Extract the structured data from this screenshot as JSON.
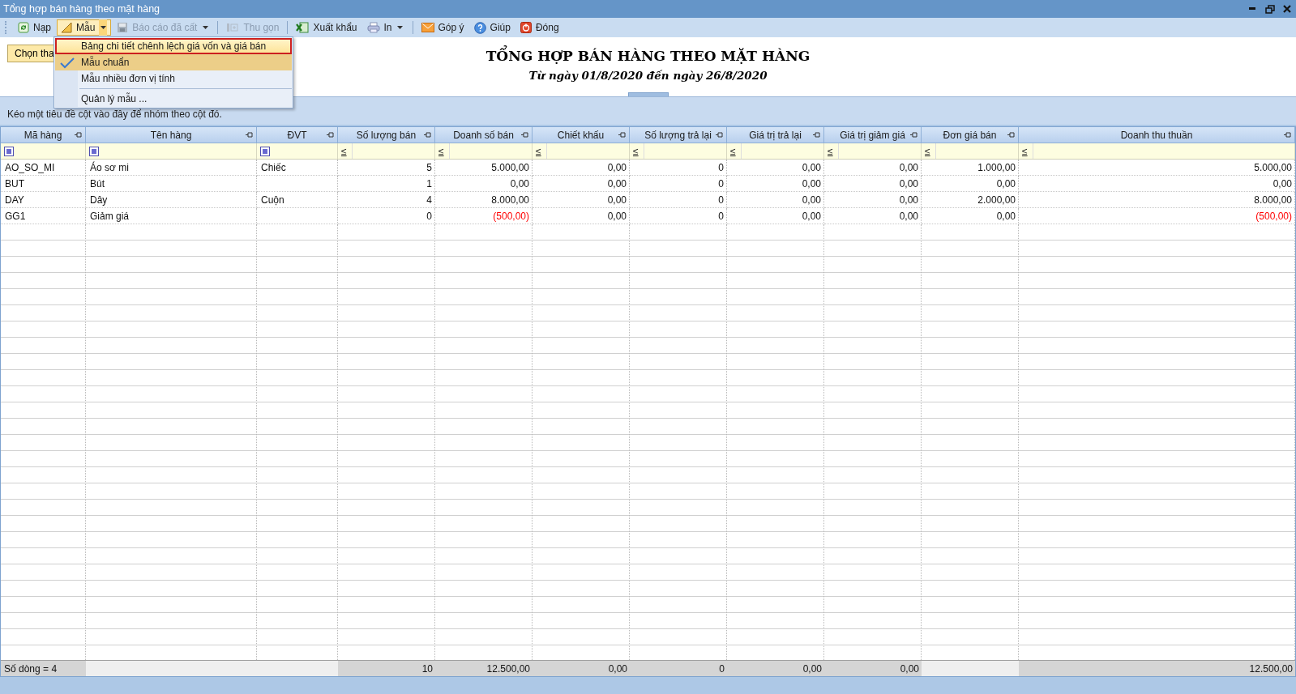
{
  "window": {
    "title": "Tổng hợp bán hàng theo mặt hàng"
  },
  "toolbar": [
    {
      "kind": "button",
      "label": "Nạp",
      "disabled": false,
      "dropdown": false,
      "open": false
    },
    {
      "kind": "button",
      "label": "Mẫu",
      "disabled": false,
      "dropdown": true,
      "open": true
    },
    {
      "kind": "button",
      "label": "Báo cáo đã cất",
      "disabled": true,
      "dropdown": true,
      "open": false
    },
    {
      "kind": "separator"
    },
    {
      "kind": "button",
      "label": "Thu gọn",
      "disabled": true,
      "dropdown": false,
      "open": false
    },
    {
      "kind": "separator"
    },
    {
      "kind": "button",
      "label": "Xuất khẩu",
      "disabled": false,
      "dropdown": false,
      "open": false
    },
    {
      "kind": "button",
      "label": "In",
      "disabled": false,
      "dropdown": true,
      "open": false
    },
    {
      "kind": "separator"
    },
    {
      "kind": "button",
      "label": "Góp ý",
      "disabled": false,
      "dropdown": false,
      "open": false
    },
    {
      "kind": "button",
      "label": "Giúp",
      "disabled": false,
      "dropdown": false,
      "open": false
    },
    {
      "kind": "button",
      "label": "Đóng",
      "disabled": false,
      "dropdown": false,
      "open": false
    }
  ],
  "menu": [
    {
      "kind": "item",
      "label": "Bảng chi tiết chênh lệch giá vốn và giá bán",
      "highlighted": true,
      "checked": false
    },
    {
      "kind": "item",
      "label": "Mẫu chuẩn",
      "highlighted": false,
      "checked": true
    },
    {
      "kind": "item",
      "label": "Mẫu nhiều đơn vị tính",
      "highlighted": false,
      "checked": false
    },
    {
      "kind": "separator"
    },
    {
      "kind": "item",
      "label": "Quản lý mẫu ...",
      "highlighted": false,
      "checked": false
    }
  ],
  "options_button": "Chọn tha",
  "report": {
    "title": "TỔNG HỢP BÁN HÀNG THEO MẶT HÀNG",
    "subtitle": "Từ ngày 01/8/2020 đến ngày 26/8/2020"
  },
  "group_panel": "Kéo một tiêu đề cột vào đây để nhóm theo cột đó.",
  "table": {
    "columns": [
      {
        "label": "Mã hàng",
        "kind": "text"
      },
      {
        "label": "Tên hàng",
        "kind": "text"
      },
      {
        "label": "ĐVT",
        "kind": "text"
      },
      {
        "label": "Số lượng bán",
        "kind": "number"
      },
      {
        "label": "Doanh số bán",
        "kind": "number"
      },
      {
        "label": "Chiết khấu",
        "kind": "number"
      },
      {
        "label": "Số lượng trả lại",
        "kind": "number"
      },
      {
        "label": "Giá trị trả lại",
        "kind": "number"
      },
      {
        "label": "Giá trị giảm giá",
        "kind": "number"
      },
      {
        "label": "Đơn giá bán",
        "kind": "number"
      },
      {
        "label": "Doanh thu thuần",
        "kind": "number"
      }
    ],
    "filter_symbol": "≤",
    "rows": [
      {
        "cells": [
          "AO_SO_MI",
          "Áo sơ mi",
          "Chiếc",
          "5",
          "5.000,00",
          "0,00",
          "0",
          "0,00",
          "0,00",
          "1.000,00",
          "5.000,00"
        ]
      },
      {
        "cells": [
          "BUT",
          "Bút",
          null,
          "1",
          "0,00",
          "0,00",
          "0",
          "0,00",
          "0,00",
          "0,00",
          "0,00"
        ]
      },
      {
        "cells": [
          "DAY",
          "Dây",
          "Cuộn",
          "4",
          "8.000,00",
          "0,00",
          "0",
          "0,00",
          "0,00",
          "2.000,00",
          "8.000,00"
        ]
      },
      {
        "cells": [
          "GG1",
          "Giảm giá",
          null,
          "0",
          {
            "text": "(500,00)",
            "negative": true
          },
          "0,00",
          "0",
          "0,00",
          "0,00",
          "0,00",
          {
            "text": "(500,00)",
            "negative": true
          }
        ]
      }
    ],
    "footer": [
      {
        "kind": "label",
        "text": "Số dòng = 4"
      },
      {
        "kind": "blank"
      },
      {
        "kind": "blank"
      },
      {
        "kind": "total",
        "text": "10"
      },
      {
        "kind": "total",
        "text": "12.500,00"
      },
      {
        "kind": "total",
        "text": "0,00"
      },
      {
        "kind": "total",
        "text": "0"
      },
      {
        "kind": "total",
        "text": "0,00"
      },
      {
        "kind": "total",
        "text": "0,00"
      },
      {
        "kind": "blank"
      },
      {
        "kind": "total",
        "text": "12.500,00"
      }
    ]
  }
}
